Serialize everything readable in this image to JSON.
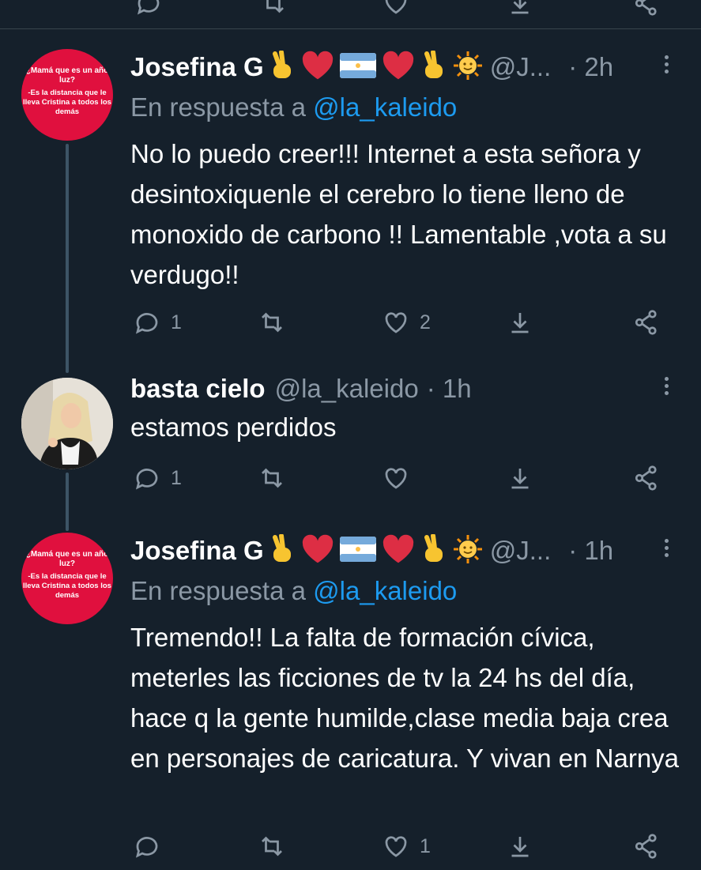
{
  "tweets": [
    {
      "name": "Josefina G",
      "handle": "@J...",
      "time": "· 2h",
      "reply_prefix": "En respuesta a",
      "reply_handle": "@la_kaleido",
      "text": "No lo puedo creer!!! Internet a esta señora y desintoxiquenle el cerebro lo tiene lleno de monoxido de carbono !! Lamentable ,vota a su verdugo!!",
      "avatar_text_1": "¿Mamá que es un año luz?",
      "avatar_text_2": "-Es la distancia que le lleva Cristina a todos los demás",
      "replies": "1",
      "retweets": "",
      "likes": "2"
    },
    {
      "name": "basta cielo",
      "handle": "@la_kaleido",
      "time": "· 1h",
      "text": "estamos perdidos",
      "replies": "1",
      "retweets": "",
      "likes": ""
    },
    {
      "name": "Josefina G",
      "handle": "@J...",
      "time": "· 1h",
      "reply_prefix": "En respuesta a",
      "reply_handle": "@la_kaleido",
      "text": "Tremendo!! La falta de formación cívica, meterles las ficciones de tv la 24 hs del día, hace q la gente humilde,clase media baja crea en personajes de caricatura. Y vivan en Narnya",
      "avatar_text_1": "¿Mamá que es un año luz?",
      "avatar_text_2": "-Es la distancia que le lleva Cristina a todos los demás",
      "replies": "",
      "retweets": "",
      "likes": "1"
    }
  ],
  "name_emojis": [
    "victory-hand",
    "red-heart",
    "argentina-flag",
    "red-heart",
    "victory-hand",
    "sun-with-face"
  ],
  "colors": {
    "background": "#15202b",
    "secondary_text": "#8b98a5",
    "link": "#1d9bf0",
    "avatar_red": "#e0103e",
    "thread_line": "#3d5466"
  }
}
